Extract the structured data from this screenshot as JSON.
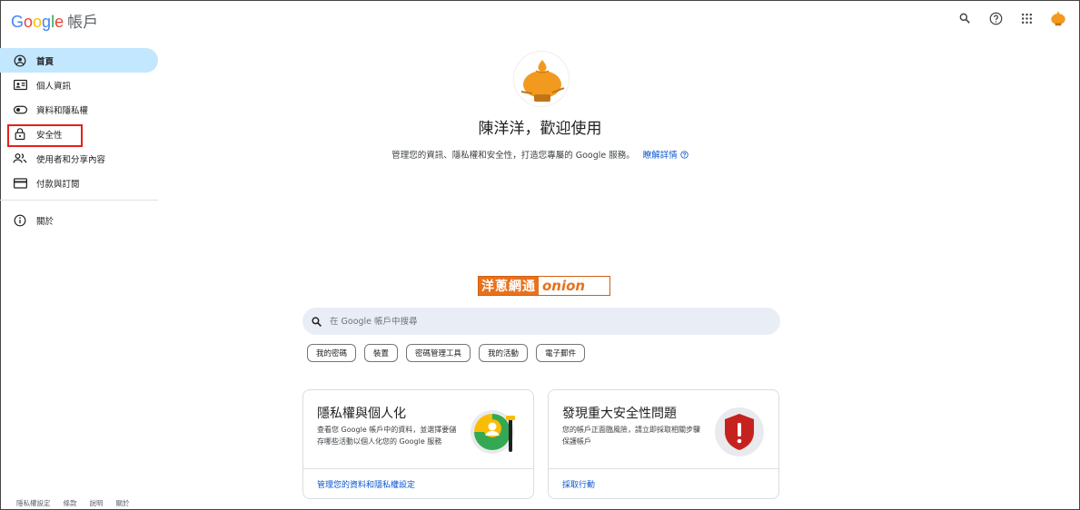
{
  "header": {
    "logo_letters": [
      "G",
      "o",
      "o",
      "g",
      "l",
      "e"
    ],
    "logo_colors": [
      "#4285f4",
      "#ea4335",
      "#fbbc05",
      "#4285f4",
      "#34a853",
      "#ea4335"
    ],
    "product_name": "帳戶"
  },
  "sidebar": {
    "items": [
      {
        "label": "首頁",
        "icon": "account-circle-icon"
      },
      {
        "label": "個人資訊",
        "icon": "id-card-icon"
      },
      {
        "label": "資料和隱私權",
        "icon": "toggle-icon"
      },
      {
        "label": "安全性",
        "icon": "lock-icon"
      },
      {
        "label": "使用者和分享內容",
        "icon": "people-icon"
      },
      {
        "label": "付款與訂閱",
        "icon": "credit-card-icon"
      },
      {
        "label": "關於",
        "icon": "info-icon"
      }
    ]
  },
  "main": {
    "welcome": "陳洋洋，歡迎使用",
    "subtitle": "管理您的資訊、隱私權和安全性，打造您專屬的 Google 服務。",
    "learn_more": "瞭解詳情",
    "watermark_left": "洋蔥網通",
    "watermark_right": "onion",
    "search_placeholder": "在 Google 帳戶中搜尋",
    "chips": [
      "我的密碼",
      "裝置",
      "密碼管理工具",
      "我的活動",
      "電子郵件"
    ],
    "cards": [
      {
        "title": "隱私權與個人化",
        "desc": "查看您 Google 帳戶中的資料，並選擇要儲存哪些活動以個人化您的 Google 服務",
        "link": "管理您的資料和隱私權設定"
      },
      {
        "title": "發現重大安全性問題",
        "desc": "您的帳戶正面臨風險，請立即採取相關步驟保護帳戶",
        "link": "採取行動"
      }
    ]
  },
  "footer": [
    "隱私權設定",
    "條款",
    "說明",
    "關於"
  ],
  "colors": {
    "accent": "#0b57d0",
    "active_bg": "#c2e7ff",
    "highlight": "#e3201b",
    "avatar_orange": "#f29a1f"
  }
}
